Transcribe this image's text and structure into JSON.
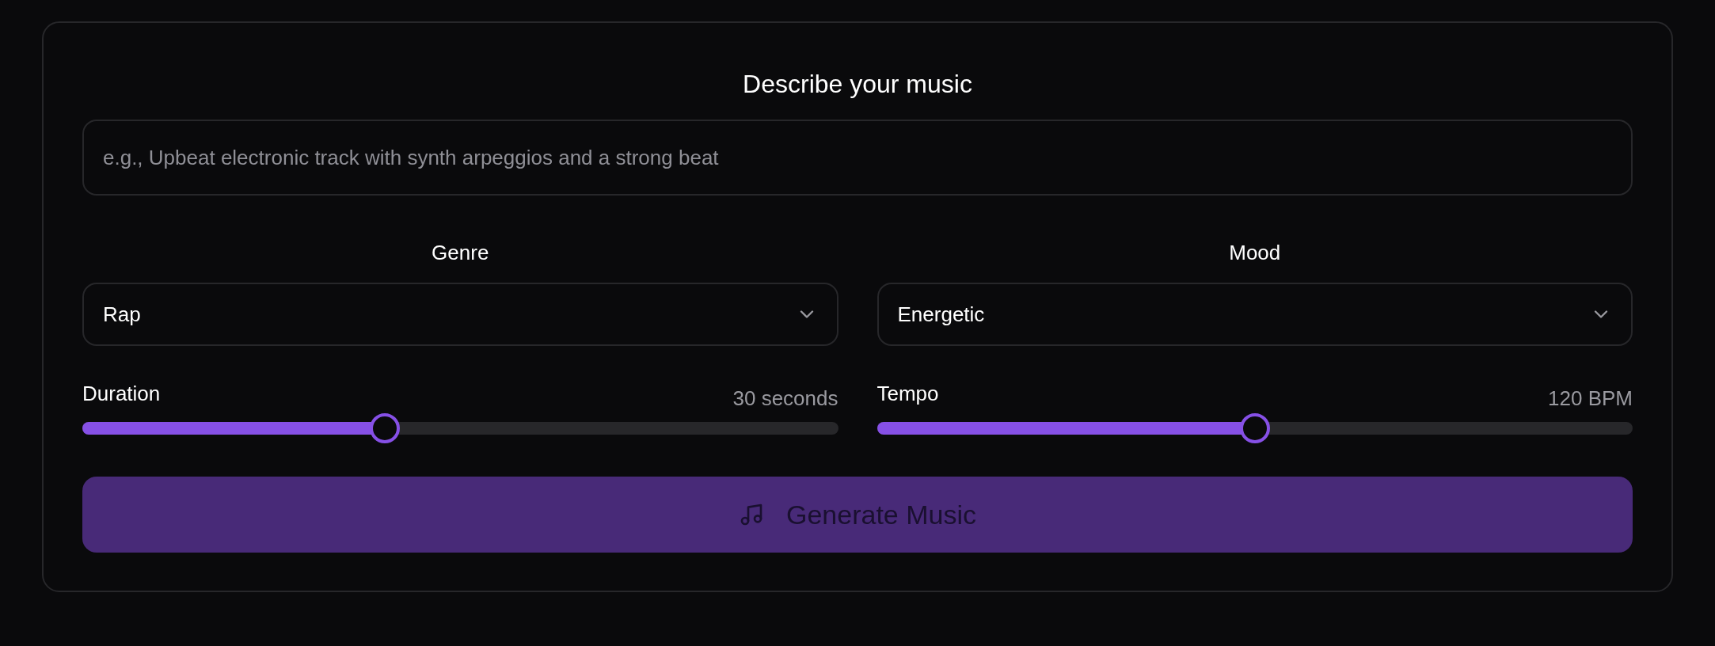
{
  "title": "Describe your music",
  "prompt": {
    "placeholder": "e.g., Upbeat electronic track with synth arpeggios and a strong beat"
  },
  "selects": [
    {
      "label": "Genre",
      "value": "Rap"
    },
    {
      "label": "Mood",
      "value": "Energetic"
    }
  ],
  "sliders": [
    {
      "label": "Duration",
      "reading": "30 seconds",
      "level": 0.4
    },
    {
      "label": "Tempo",
      "reading": "120 BPM",
      "level": 0.5
    }
  ],
  "generate_button": {
    "label": "Generate Music",
    "disabled": true
  }
}
